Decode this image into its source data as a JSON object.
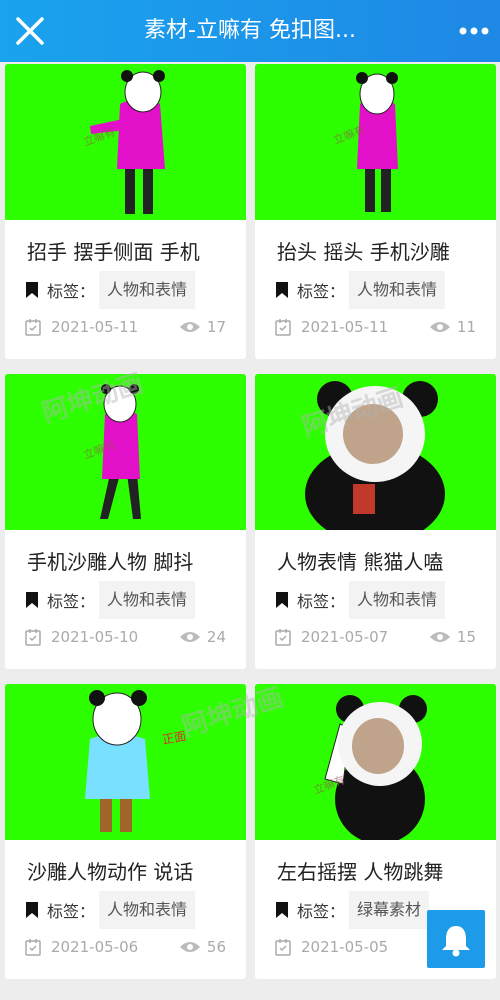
{
  "header": {
    "title": "素材-立嘛有 免扣图...",
    "close_icon": "close-icon",
    "more_icon": "more-icon"
  },
  "cards": [
    {
      "title": "招手 摆手侧面 手机",
      "tag_label": "标签：",
      "tag_value": "人物和表情",
      "date": "2021-05-11",
      "views": "17",
      "thumb": "pink-panda-waving"
    },
    {
      "title": "抬头 摇头 手机沙雕",
      "tag_label": "标签：",
      "tag_value": "人物和表情",
      "date": "2021-05-11",
      "views": "11",
      "thumb": "pink-panda-standing"
    },
    {
      "title": "手机沙雕人物 脚抖",
      "tag_label": "标签：",
      "tag_value": "人物和表情",
      "date": "2021-05-10",
      "views": "24",
      "thumb": "pink-panda-shaking"
    },
    {
      "title": "人物表情 熊猫人嗑",
      "tag_label": "标签：",
      "tag_value": "人物和表情",
      "date": "2021-05-07",
      "views": "15",
      "thumb": "panda-eating"
    },
    {
      "title": "沙雕人物动作 说话",
      "tag_label": "标签：",
      "tag_value": "人物和表情",
      "date": "2021-05-06",
      "views": "56",
      "thumb": "blue-shirt-panda"
    },
    {
      "title": "左右摇摆 人物跳舞",
      "tag_label": "标签：",
      "tag_value": "绿幕素材",
      "date": "2021-05-05",
      "views": "",
      "thumb": "panda-dancing"
    }
  ],
  "watermarks": {
    "main": "阿坤动画",
    "small": "立嘛有",
    "zheng": "正面"
  },
  "colors": {
    "header": "#1e88e5",
    "green_screen": "#2dff00",
    "bell_button": "#1e9be8"
  },
  "fab": {
    "icon": "bell-icon"
  }
}
